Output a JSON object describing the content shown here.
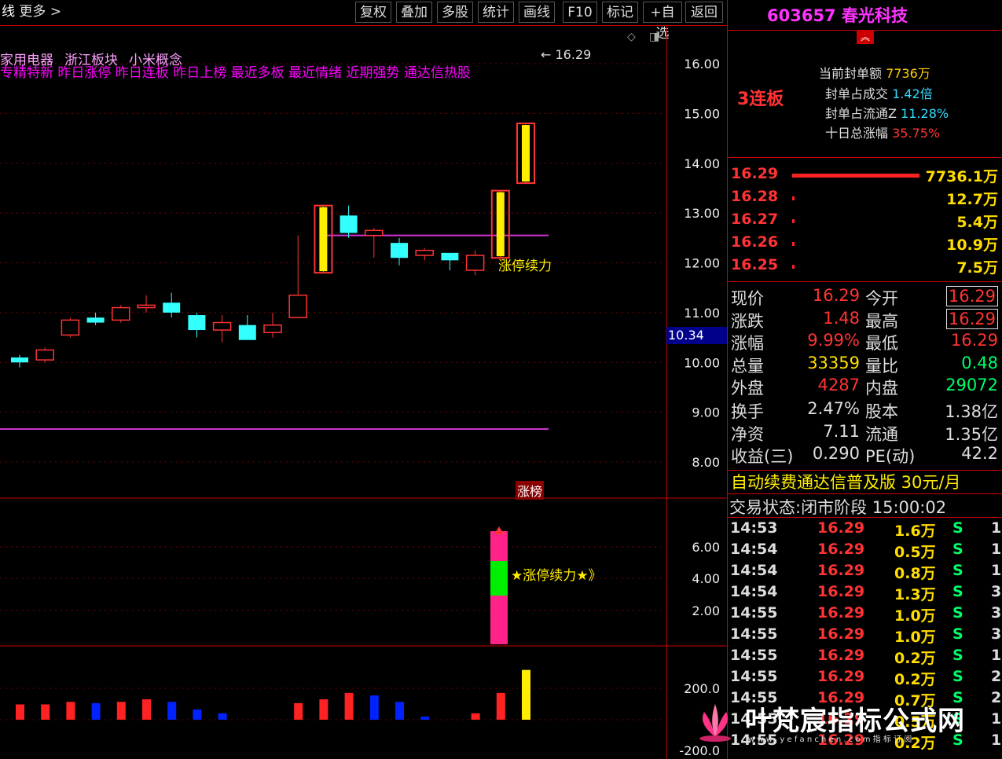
{
  "toolbar": {
    "more": "更多",
    "buttons": [
      "复权",
      "叠加",
      "多股",
      "统计",
      "画线",
      "F10",
      "标记",
      "+自选",
      "返回"
    ]
  },
  "chart": {
    "tags_line1": [
      "家用电器",
      "浙江板块",
      "小米概念"
    ],
    "tags_line2": "专精特新 昨日涨停 昨日连板 昨日上榜 最近多板 最近情绪 近期强势 通达信热股",
    "high_marker": "16.29",
    "price_axis": [
      "16.00",
      "15.00",
      "14.00",
      "13.00",
      "12.00",
      "11.00",
      "10.00",
      "9.00",
      "8.00"
    ],
    "current_label": "10.34",
    "annotation": "涨停续力",
    "zhangbang": "涨榜",
    "ind_axis": [
      "6.00",
      "4.00",
      "2.00"
    ],
    "ind_label": "★涨停续力★》",
    "vol_axis": [
      "200.0",
      "-200.0"
    ],
    "candles": [
      {
        "o": 10.1,
        "c": 10.0,
        "h": 10.15,
        "l": 9.9,
        "up": false
      },
      {
        "o": 10.05,
        "c": 10.25,
        "h": 10.3,
        "l": 10.0,
        "up": true
      },
      {
        "o": 10.55,
        "c": 10.85,
        "h": 10.9,
        "l": 10.5,
        "up": true
      },
      {
        "o": 10.9,
        "c": 10.8,
        "h": 11.0,
        "l": 10.75,
        "up": false
      },
      {
        "o": 10.85,
        "c": 11.1,
        "h": 11.15,
        "l": 10.8,
        "up": true
      },
      {
        "o": 11.15,
        "c": 11.1,
        "h": 11.35,
        "l": 11.0,
        "up": true
      },
      {
        "o": 11.2,
        "c": 11.0,
        "h": 11.4,
        "l": 10.9,
        "up": false
      },
      {
        "o": 10.95,
        "c": 10.65,
        "h": 11.0,
        "l": 10.5,
        "up": false
      },
      {
        "o": 10.65,
        "c": 10.8,
        "h": 10.95,
        "l": 10.4,
        "up": true
      },
      {
        "o": 10.75,
        "c": 10.45,
        "h": 10.95,
        "l": 10.45,
        "up": false
      },
      {
        "o": 10.6,
        "c": 10.75,
        "h": 11.0,
        "l": 10.5,
        "up": true
      },
      {
        "o": 10.9,
        "c": 11.35,
        "h": 12.55,
        "l": 10.9,
        "up": true
      },
      {
        "o": 11.8,
        "c": 13.15,
        "h": 13.15,
        "l": 11.8,
        "up": true,
        "lim": true
      },
      {
        "o": 12.95,
        "c": 12.6,
        "h": 13.15,
        "l": 12.5,
        "up": false
      },
      {
        "o": 12.55,
        "c": 12.65,
        "h": 12.7,
        "l": 12.1,
        "up": true
      },
      {
        "o": 12.4,
        "c": 12.1,
        "h": 12.5,
        "l": 11.95,
        "up": false
      },
      {
        "o": 12.15,
        "c": 12.25,
        "h": 12.3,
        "l": 12.05,
        "up": true
      },
      {
        "o": 12.2,
        "c": 12.05,
        "h": 12.2,
        "l": 11.85,
        "up": false
      },
      {
        "o": 11.85,
        "c": 12.15,
        "h": 12.25,
        "l": 11.75,
        "up": true
      },
      {
        "o": 12.1,
        "c": 13.45,
        "h": 13.45,
        "l": 12.1,
        "up": true,
        "lim": true
      },
      {
        "o": 13.6,
        "c": 14.8,
        "h": 14.8,
        "l": 13.6,
        "up": true,
        "lim": true
      }
    ],
    "vols": [
      {
        "v": 60,
        "c": "#ff2222"
      },
      {
        "v": 60,
        "c": "#ff2222"
      },
      {
        "v": 70,
        "c": "#ff2222"
      },
      {
        "v": 65,
        "c": "#0022ff"
      },
      {
        "v": 70,
        "c": "#ff2222"
      },
      {
        "v": 80,
        "c": "#ff2222"
      },
      {
        "v": 70,
        "c": "#0022ff"
      },
      {
        "v": 40,
        "c": "#0022ff"
      },
      {
        "v": 25,
        "c": "#0022ff"
      },
      {
        "v": 0,
        "c": "#ff2222"
      },
      {
        "v": 0,
        "c": "#ff2222"
      },
      {
        "v": 65,
        "c": "#ff2222"
      },
      {
        "v": 80,
        "c": "#ff2222"
      },
      {
        "v": 105,
        "c": "#ff2222"
      },
      {
        "v": 95,
        "c": "#0022ff"
      },
      {
        "v": 70,
        "c": "#0022ff"
      },
      {
        "v": 12,
        "c": "#0022ff"
      },
      {
        "v": 0,
        "c": "#ff2222"
      },
      {
        "v": 25,
        "c": "#ff2222"
      },
      {
        "v": 105,
        "c": "#ff2222"
      },
      {
        "v": 195,
        "c": "#ffee00"
      }
    ]
  },
  "stock": {
    "code": "603657",
    "name": "春光科技"
  },
  "lianban": "3连板",
  "seal": {
    "l1": "当前封单额",
    "v1": "7736万",
    "l2": "封单占成交",
    "v2": "1.42倍",
    "l3": "封单占流通Z",
    "v3": "11.28%",
    "l4": "十日总涨幅",
    "v4": "35.75%"
  },
  "bids": [
    {
      "price": "16.29",
      "vol": "7736.1万"
    },
    {
      "price": "16.28",
      "vol": "12.7万"
    },
    {
      "price": "16.27",
      "vol": "5.4万"
    },
    {
      "price": "16.26",
      "vol": "10.9万"
    },
    {
      "price": "16.25",
      "vol": "7.5万"
    }
  ],
  "quote": [
    {
      "l1": "现价",
      "v1": "16.29",
      "c1": "#ff3333",
      "l2": "今开",
      "v2": "16.29",
      "c2": "#ff3333"
    },
    {
      "l1": "涨跌",
      "v1": "1.48",
      "c1": "#ff3333",
      "l2": "最高",
      "v2": "16.29",
      "c2": "#ff3333"
    },
    {
      "l1": "涨幅",
      "v1": "9.99%",
      "c1": "#ff3333",
      "l2": "最低",
      "v2": "16.29",
      "c2": "#ff3333"
    },
    {
      "l1": "总量",
      "v1": "33359",
      "c1": "#ffdd00",
      "l2": "量比",
      "v2": "0.48",
      "c2": "#00ff66"
    },
    {
      "l1": "外盘",
      "v1": "4287",
      "c1": "#ff3333",
      "l2": "内盘",
      "v2": "29072",
      "c2": "#00ff66"
    },
    {
      "l1": "换手",
      "v1": "2.47%",
      "c1": "#ddd",
      "l2": "股本",
      "v2": "1.38亿",
      "c2": "#ddd"
    },
    {
      "l1": "净资",
      "v1": "7.11",
      "c1": "#ddd",
      "l2": "流通",
      "v2": "1.35亿",
      "c2": "#ddd"
    },
    {
      "l1": "收益(三)",
      "v1": "0.290",
      "c1": "#ddd",
      "l2": "PE(动)",
      "v2": "42.2",
      "c2": "#ddd"
    }
  ],
  "promo": "自动续费通达信普及版 30元/月",
  "trade_status": "交易状态:闭市阶段 15:00:02",
  "ticks": [
    {
      "t": "14:53",
      "p": "16.29",
      "v": "1.6万",
      "bs": "S",
      "n": "1"
    },
    {
      "t": "14:54",
      "p": "16.29",
      "v": "0.5万",
      "bs": "S",
      "n": "1"
    },
    {
      "t": "14:54",
      "p": "16.29",
      "v": "0.8万",
      "bs": "S",
      "n": "1"
    },
    {
      "t": "14:54",
      "p": "16.29",
      "v": "1.3万",
      "bs": "S",
      "n": "3"
    },
    {
      "t": "14:55",
      "p": "16.29",
      "v": "1.0万",
      "bs": "S",
      "n": "3"
    },
    {
      "t": "14:55",
      "p": "16.29",
      "v": "1.0万",
      "bs": "S",
      "n": "3"
    },
    {
      "t": "14:55",
      "p": "16.29",
      "v": "0.2万",
      "bs": "S",
      "n": "1"
    },
    {
      "t": "14:55",
      "p": "16.29",
      "v": "0.2万",
      "bs": "S",
      "n": "2"
    },
    {
      "t": "14:55",
      "p": "16.29",
      "v": "0.7万",
      "bs": "S",
      "n": "2"
    },
    {
      "t": "14:55",
      "p": "16.29",
      "v": "0.5万",
      "bs": "S",
      "n": "1"
    },
    {
      "t": "14:55",
      "p": "16.29",
      "v": "0.2万",
      "bs": "S",
      "n": "1"
    }
  ],
  "watermark": {
    "main": "叶梵宸指标公式网",
    "sub": "w w w . y e f a n c h e n . c o m   指 标 订 阅"
  }
}
